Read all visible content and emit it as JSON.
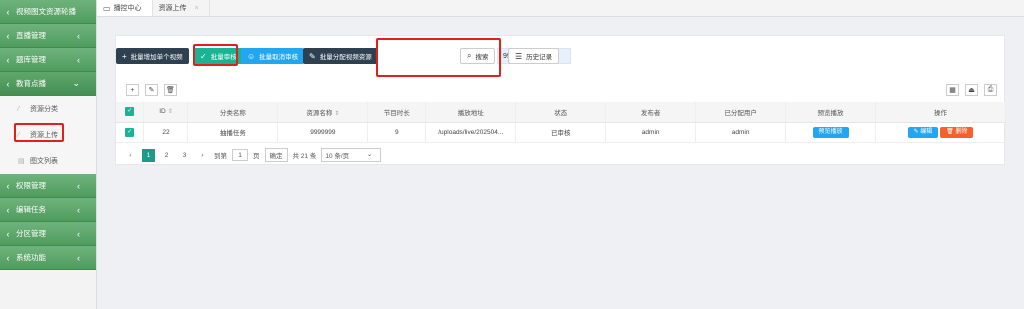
{
  "sidebar": {
    "groups_top": [
      {
        "label": "视频图文资源轮播"
      },
      {
        "label": "直播管理"
      },
      {
        "label": "题库管理"
      }
    ],
    "open_group": {
      "label": "教育点播"
    },
    "sub_items": [
      {
        "label": "资源分类"
      },
      {
        "label": "资源上传"
      },
      {
        "label": "图文列表"
      }
    ],
    "groups_bottom": [
      {
        "label": "权限管理"
      },
      {
        "label": "编辑任务"
      },
      {
        "label": "分区管理"
      },
      {
        "label": "系统功能"
      }
    ]
  },
  "tabs": [
    {
      "label": "播控中心"
    },
    {
      "label": "资源上传"
    }
  ],
  "toolbar": {
    "batch_add": "批量增加单个视频",
    "batch_review": "批量审核",
    "batch_cancel": "批量取消审核",
    "batch_assign": "批量分配视频资源",
    "search_value": "9999",
    "search_button": "搜索",
    "history_button": "历史记录"
  },
  "table": {
    "headers": [
      "ID",
      "分类名称",
      "资源名称",
      "节目时长",
      "播放地址",
      "状态",
      "发布者",
      "已分配用户",
      "预览播放",
      "操作"
    ],
    "rows": [
      {
        "id": "22",
        "category": "抽播任务",
        "name": "9999999",
        "duration": "9",
        "url": "/uploads/live/202504...",
        "status": "已审核",
        "publisher": "admin",
        "assigned": "admin",
        "preview": "预览播放",
        "edit": "编辑",
        "delete": "删除"
      }
    ]
  },
  "pager": {
    "pages": [
      "1",
      "2",
      "3"
    ],
    "goto_label": "到第",
    "page_input": "1",
    "page_unit": "页",
    "confirm": "确定",
    "total": "共 21 条",
    "page_size": "10 条/页"
  },
  "colors": {
    "accent_green": "#1ab394",
    "sidebar_green": "#5ea86c",
    "highlight_red": "#e0201a",
    "blue": "#23a6f0",
    "orange": "#f4612a"
  }
}
